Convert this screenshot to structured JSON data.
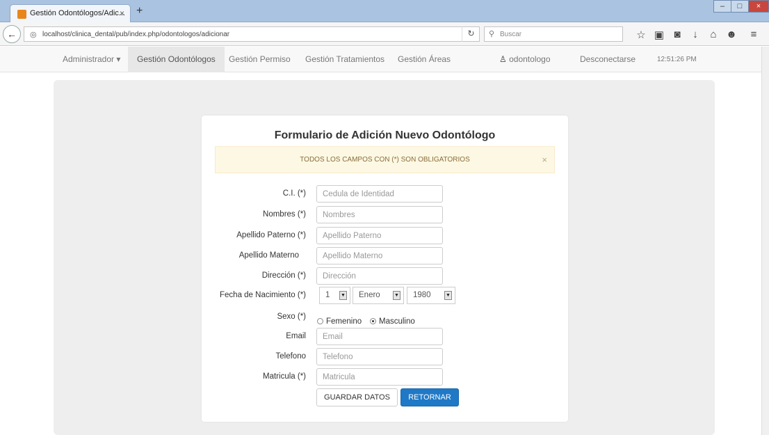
{
  "browser": {
    "tab_title": "Gestión Odontólogos/Adic...",
    "tab_close": "×",
    "new_tab": "+",
    "url": "localhost/clinica_dental/pub/index.php/odontologos/adicionar",
    "search_placeholder": "Buscar",
    "window_buttons": {
      "min": "–",
      "max": "□",
      "close": "×"
    }
  },
  "nav": {
    "items": [
      {
        "label": "Administrador ▾"
      },
      {
        "label": "Gestión Odontólogos"
      },
      {
        "label": "Gestión Permiso"
      },
      {
        "label": "Gestión Tratamientos"
      },
      {
        "label": "Gestión Áreas"
      }
    ],
    "user": "odontologo",
    "user_icon": "person-icon",
    "logout": "Desconectarse",
    "clock": "12:51:26 PM"
  },
  "form": {
    "title": "Formulario de Adición Nuevo Odontólogo",
    "alert": "TODOS LOS CAMPOS CON (*) SON OBLIGATORIOS",
    "alert_close": "×",
    "fields": [
      {
        "label": "C.I. (*)",
        "placeholder": "Cedula de Identidad"
      },
      {
        "label": "Nombres (*)",
        "placeholder": "Nombres"
      },
      {
        "label": "Apellido Paterno (*)",
        "placeholder": "Apellido Paterno"
      },
      {
        "label": "Apellido Materno",
        "placeholder": "Apellido Materno"
      },
      {
        "label": "Dirección (*)",
        "placeholder": "Dirección"
      }
    ],
    "fecha": {
      "label": "Fecha de Nacimiento (*)",
      "day": "1",
      "month": "Enero",
      "year": "1980"
    },
    "sexo": {
      "label": "Sexo (*)",
      "options": [
        "Femenino",
        "Masculino"
      ],
      "selected": "Masculino"
    },
    "fields2": [
      {
        "label": "Email",
        "placeholder": "Email"
      },
      {
        "label": "Telefono",
        "placeholder": "Telefono"
      },
      {
        "label": "Matricula (*)",
        "placeholder": "Matricula"
      }
    ],
    "save_label": "GUARDAR DATOS",
    "back_label": "RETORNAR"
  }
}
